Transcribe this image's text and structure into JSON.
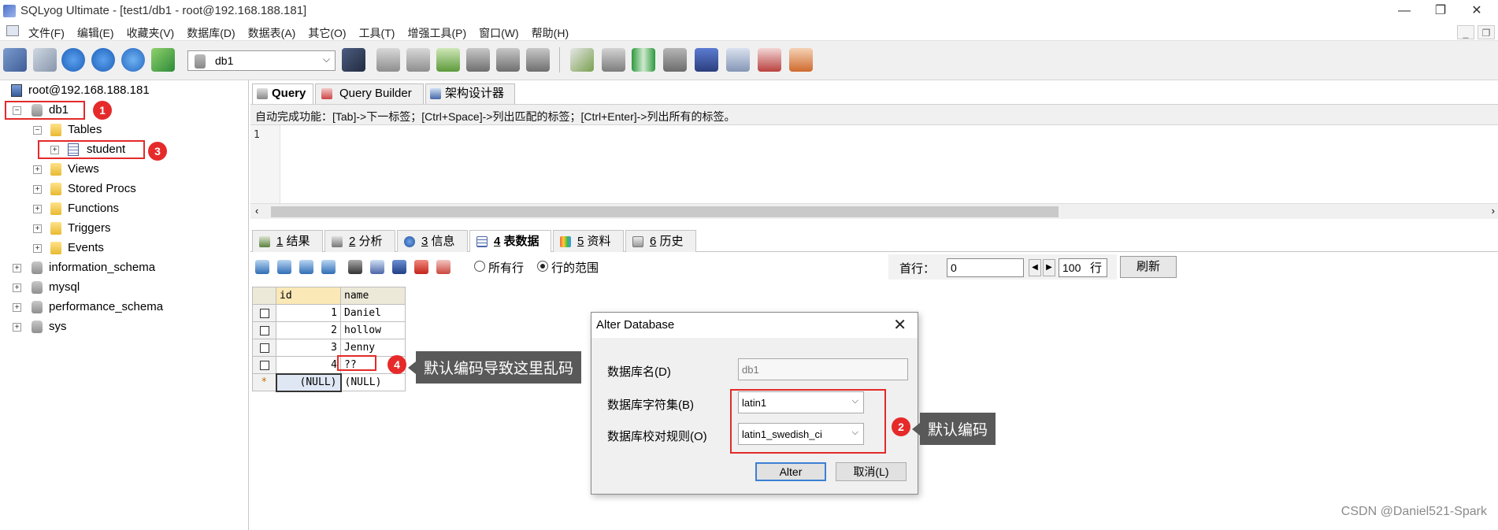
{
  "window": {
    "title": "SQLyog Ultimate - [test1/db1 - root@192.168.188.181]",
    "minimize": "—",
    "restore": "❐",
    "close": "✕"
  },
  "menu": {
    "items": [
      "文件(F)",
      "编辑(E)",
      "收藏夹(V)",
      "数据库(D)",
      "数据表(A)",
      "其它(O)",
      "工具(T)",
      "增强工具(P)",
      "窗口(W)",
      "帮助(H)"
    ],
    "mdi_min": "_",
    "mdi_restore": "❐"
  },
  "toolbar": {
    "database_select": "db1",
    "select_arrow": "⌵"
  },
  "tree": {
    "root": "root@192.168.188.181",
    "db1": "db1",
    "tables": "Tables",
    "student": "student",
    "views": "Views",
    "stored_procs": "Stored Procs",
    "functions": "Functions",
    "triggers": "Triggers",
    "events": "Events",
    "information_schema": "information_schema",
    "mysql": "mysql",
    "performance_schema": "performance_schema",
    "sys": "sys",
    "minus": "−",
    "plus": "+"
  },
  "badges": {
    "b1": "1",
    "b2": "2",
    "b3": "3",
    "b4": "4"
  },
  "query_tabs": {
    "query": "Query",
    "builder": "Query Builder",
    "schema": "架构设计器"
  },
  "hint": "自动完成功能：[Tab]->下一标签；[Ctrl+Space]->列出匹配的标签；[Ctrl+Enter]->列出所有的标签。",
  "editor": {
    "line_number": "1"
  },
  "result_tabs": {
    "t1_num": "1",
    "t1_label": "结果",
    "t2_num": "2",
    "t2_label": "分析",
    "t3_num": "3",
    "t3_label": "信息",
    "t4_num": "4",
    "t4_label": "表数据",
    "t5_num": "5",
    "t5_label": "资料",
    "t6_num": "6",
    "t6_label": "历史"
  },
  "result_toolbar": {
    "all_rows": "所有行",
    "row_range": "行的范围",
    "first_row_label": "首行：",
    "first_row_value": "0",
    "count_value": "100",
    "rows_label": "行",
    "refresh": "刷新"
  },
  "grid": {
    "columns": [
      "id",
      "name"
    ],
    "rows": [
      {
        "id": "1",
        "name": "Daniel"
      },
      {
        "id": "2",
        "name": "hollow"
      },
      {
        "id": "3",
        "name": "Jenny"
      },
      {
        "id": "4",
        "name": "??"
      }
    ],
    "new_row_marker": "*",
    "null_id": "(NULL)",
    "null_name": "(NULL)"
  },
  "callouts": {
    "garbled": "默认编码导致这里乱码",
    "default_encoding": "默认编码"
  },
  "dialog": {
    "title": "Alter Database",
    "close": "✕",
    "db_name_label": "数据库名(D)",
    "db_name_value": "db1",
    "charset_label": "数据库字符集(B)",
    "charset_value": "latin1",
    "collation_label": "数据库校对规则(O)",
    "collation_value": "latin1_swedish_ci",
    "alter_btn": "Alter",
    "cancel_btn": "取消(L)",
    "combo_arrow": "⌵"
  },
  "watermark": "CSDN @Daniel521-Spark"
}
